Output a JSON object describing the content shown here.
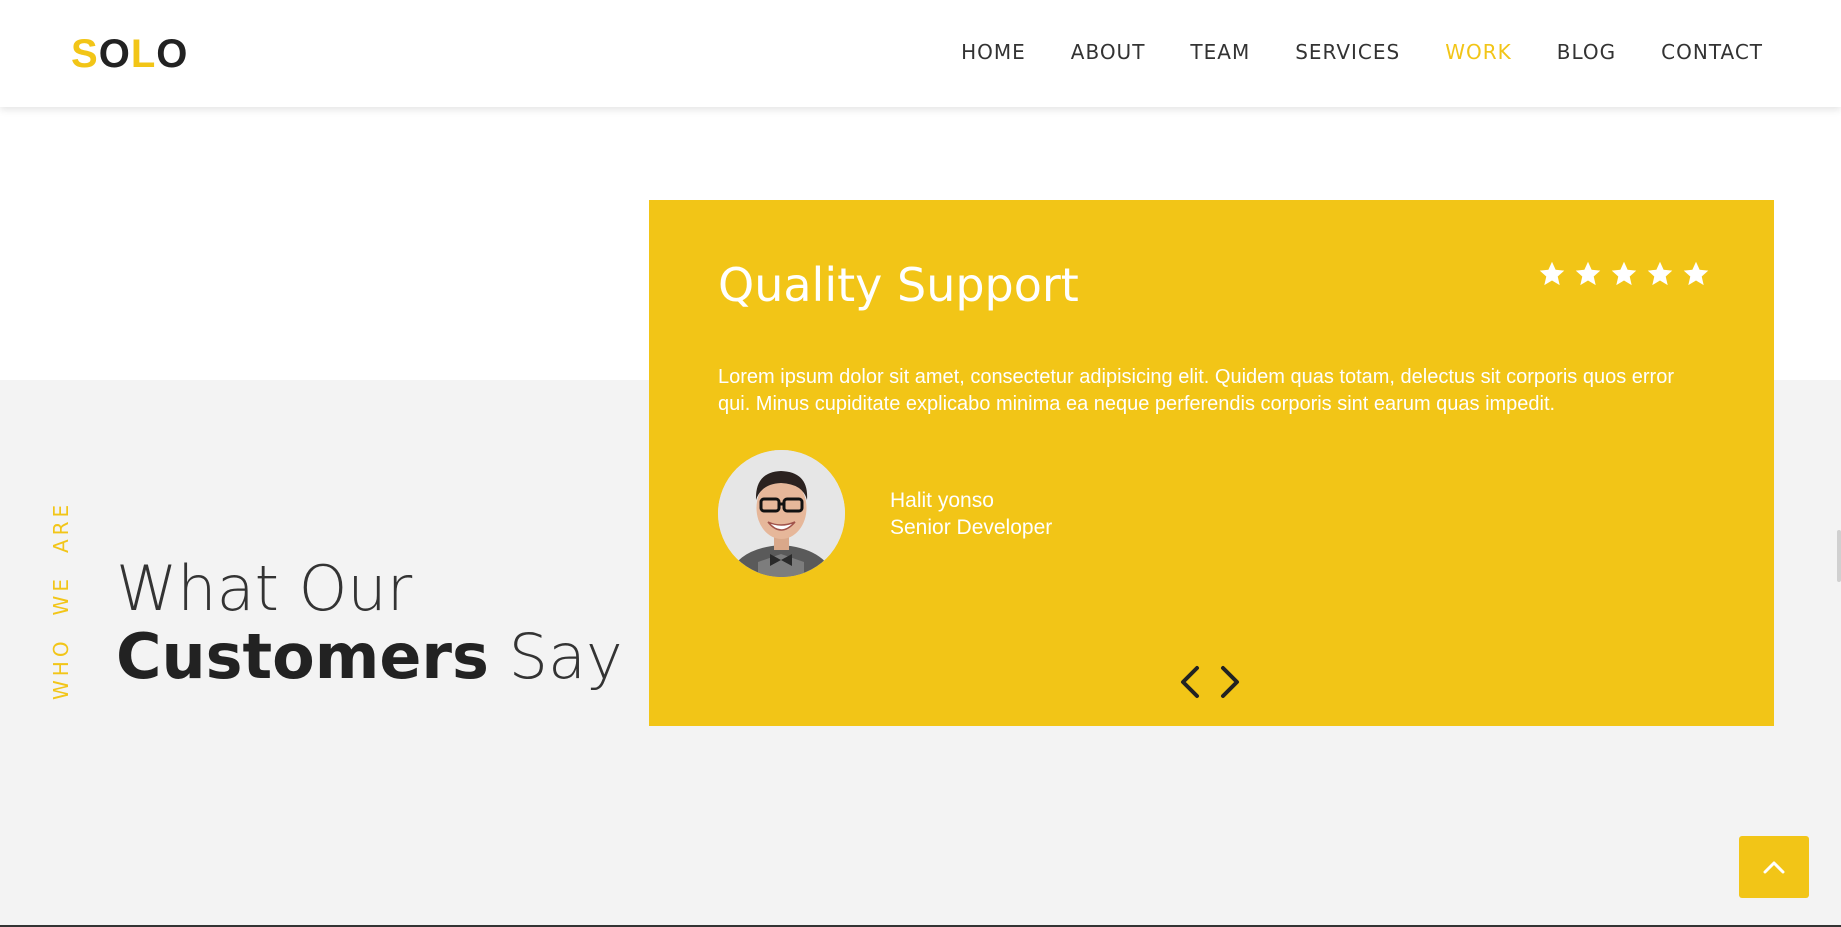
{
  "brand": {
    "letters": [
      "S",
      "O",
      "L",
      "O"
    ],
    "accent": "#f2c517",
    "dark": "#222222"
  },
  "nav": {
    "items": [
      "HOME",
      "ABOUT",
      "TEAM",
      "SERVICES",
      "WORK",
      "BLOG",
      "CONTACT"
    ],
    "active": "WORK"
  },
  "section": {
    "tag_words": [
      "WHO",
      "WE",
      "ARE"
    ],
    "heading_line1": "What Our",
    "heading_bold": "Customers",
    "heading_light": "Say"
  },
  "testimonial": {
    "title": "Quality Support",
    "rating": 5,
    "body": "Lorem ipsum dolor sit amet, consectetur adipisicing elit. Quidem quas totam, delectus sit corporis quos error qui. Minus cupiditate explicabo minima ea neque perferendis corporis sint earum quas impedit.",
    "author_name": "Halit yonso",
    "author_role": "Senior Developer",
    "avatar_icon": "person-avatar",
    "prev_icon": "chevron-left-icon",
    "next_icon": "chevron-right-icon"
  },
  "back_to_top_icon": "chevron-up-icon",
  "colors": {
    "accent": "#f2c517",
    "band": "#f3f3f3",
    "text": "#222222"
  }
}
